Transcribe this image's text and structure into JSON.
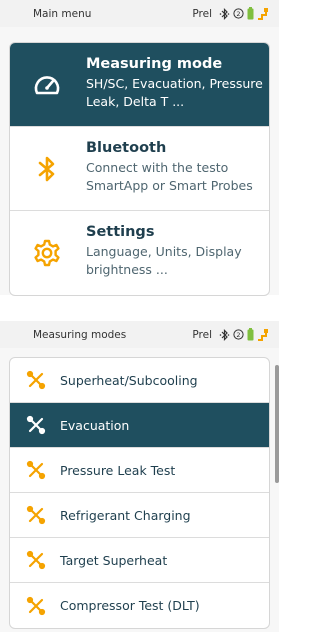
{
  "screen1": {
    "status": {
      "title": "Main menu",
      "prel": "Prel"
    },
    "menu": [
      {
        "title": "Measuring mode",
        "desc": "SH/SC, Evacuation, Pressure Leak, Delta T ...",
        "icon": "gauge-icon",
        "active": true
      },
      {
        "title": "Bluetooth",
        "desc": "Connect with the testo SmartApp or Smart Probes",
        "icon": "bluetooth-icon",
        "active": false
      },
      {
        "title": "Settings",
        "desc": "Language, Units, Display brightness ...",
        "icon": "gear-icon",
        "active": false
      }
    ]
  },
  "screen2": {
    "status": {
      "title": "Measuring modes",
      "prel": "Prel"
    },
    "items": [
      {
        "label": "Superheat/Subcooling",
        "active": false
      },
      {
        "label": "Evacuation",
        "active": true
      },
      {
        "label": "Pressure Leak Test",
        "active": false
      },
      {
        "label": "Refrigerant Charging",
        "active": false
      },
      {
        "label": "Target Superheat",
        "active": false
      },
      {
        "label": "Compressor Test (DLT)",
        "active": false
      }
    ]
  },
  "colors": {
    "accent": "#f5a300",
    "active_bg": "#1f4f5f",
    "text": "#1f3f4e",
    "battery": "#7fbf3f"
  }
}
